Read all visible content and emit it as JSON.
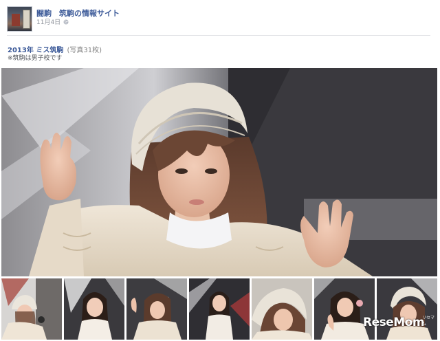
{
  "post": {
    "page_name": "闘駒　筑駒の情報サイト",
    "date": "11月4日",
    "privacy_icon": "globe-icon"
  },
  "album": {
    "title": "2013年 ミス筑駒",
    "count": "(写真31枚)",
    "note": "※筑駒は男子校です"
  },
  "photos": {
    "main": {
      "description_icon": "photo"
    },
    "thumbnails_count": 7
  },
  "watermark": {
    "brand": "ReseMom",
    "sub": "リセマム",
    "colors": {
      "text": "#ffffff"
    }
  },
  "colors": {
    "link": "#3b5998",
    "meta": "#90949c",
    "count": "#7f7f7f",
    "note": "#4b4f56",
    "divider": "#e1e2e6"
  }
}
